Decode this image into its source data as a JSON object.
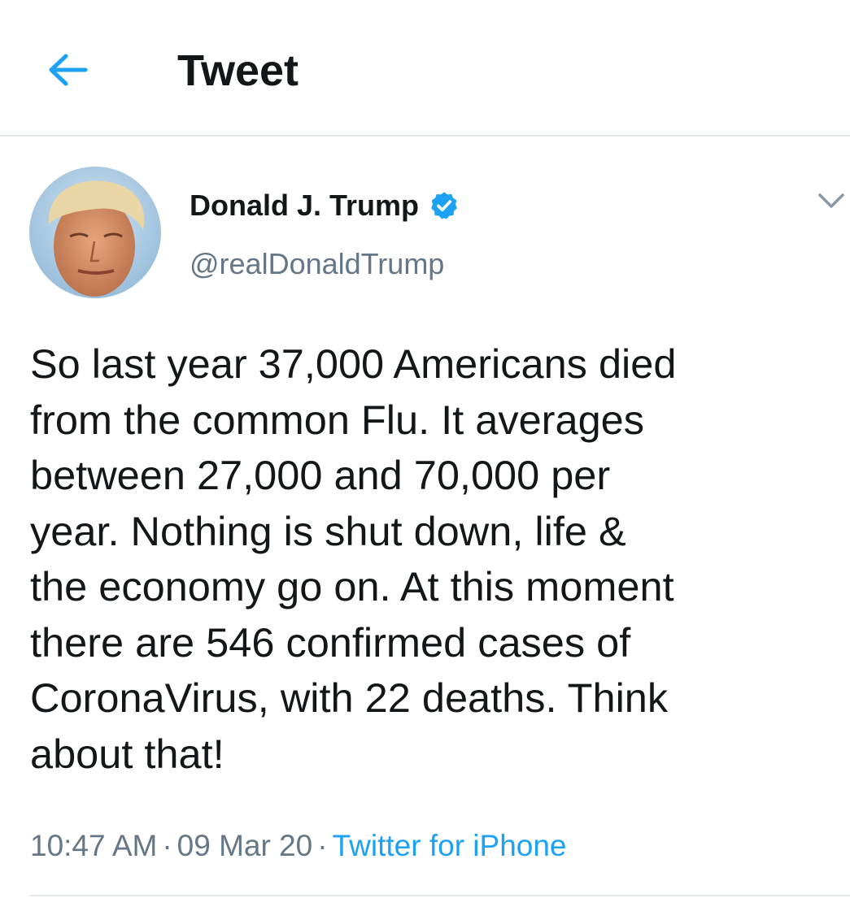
{
  "header": {
    "back_icon": "arrow-left-icon",
    "title": "Tweet"
  },
  "tweet": {
    "author": {
      "name": "Donald J. Trump",
      "handle": "@realDonaldTrump",
      "verified_icon": "verified-badge-icon"
    },
    "menu_icon": "chevron-down-icon",
    "text": "So last year 37,000 Americans died\nfrom the common Flu. It averages\nbetween 27,000 and 70,000 per\nyear. Nothing is shut down, life &\nthe economy go on. At this moment\nthere are 546 confirmed cases of\nCoronaVirus, with 22 deaths. Think\nabout that!",
    "time": "10:47 AM",
    "date": "09 Mar 20",
    "separator": "·",
    "source": "Twitter for iPhone"
  },
  "colors": {
    "accent": "#1da1f2",
    "text": "#14171a",
    "secondary": "#657786",
    "divider": "#e1e8ed"
  }
}
